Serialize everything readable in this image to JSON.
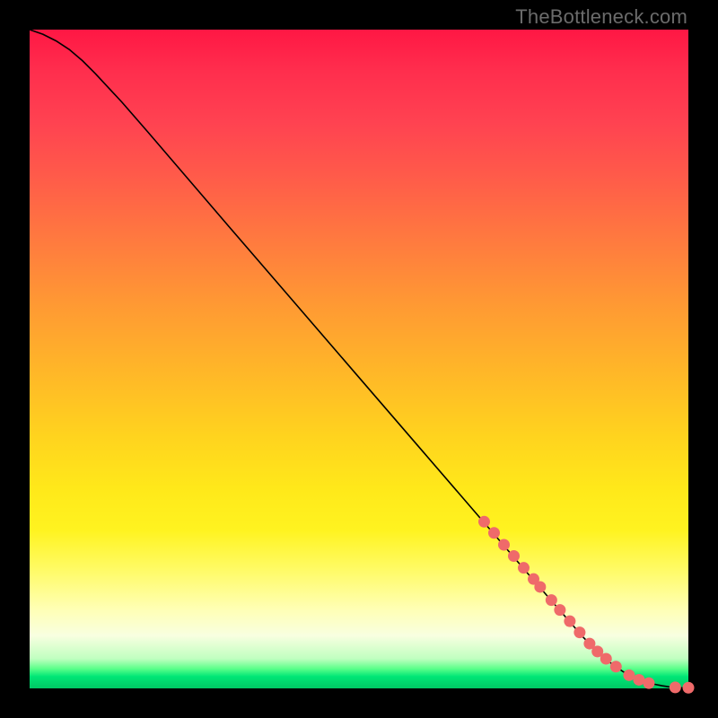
{
  "watermark": "TheBottleneck.com",
  "chart_data": {
    "type": "line",
    "title": "",
    "xlabel": "",
    "ylabel": "",
    "xlim": [
      0,
      100
    ],
    "ylim": [
      0,
      100
    ],
    "grid": false,
    "legend": false,
    "series": [
      {
        "name": "curve",
        "color": "#000000",
        "x": [
          0,
          2,
          4,
          6,
          8,
          10,
          14,
          18,
          24,
          30,
          40,
          50,
          60,
          70,
          76,
          80,
          84,
          86,
          88,
          90,
          91,
          92,
          93,
          94.5,
          96,
          97,
          98,
          99,
          100
        ],
        "y": [
          100,
          99.3,
          98.3,
          97.0,
          95.3,
          93.3,
          89.0,
          84.4,
          77.4,
          70.4,
          58.8,
          47.2,
          35.6,
          24.0,
          17.0,
          12.4,
          7.8,
          5.8,
          4.0,
          2.6,
          2.0,
          1.5,
          1.1,
          0.7,
          0.4,
          0.25,
          0.15,
          0.1,
          0.1
        ]
      }
    ],
    "markers": {
      "name": "dots",
      "color": "#ef6a6a",
      "radius_px": 6.5,
      "points": [
        {
          "x": 69.0,
          "y": 25.3
        },
        {
          "x": 70.5,
          "y": 23.6
        },
        {
          "x": 72.0,
          "y": 21.8
        },
        {
          "x": 73.5,
          "y": 20.1
        },
        {
          "x": 75.0,
          "y": 18.3
        },
        {
          "x": 76.5,
          "y": 16.6
        },
        {
          "x": 77.5,
          "y": 15.4
        },
        {
          "x": 79.2,
          "y": 13.4
        },
        {
          "x": 80.5,
          "y": 11.9
        },
        {
          "x": 82.0,
          "y": 10.2
        },
        {
          "x": 83.5,
          "y": 8.5
        },
        {
          "x": 85.0,
          "y": 6.8
        },
        {
          "x": 86.2,
          "y": 5.6
        },
        {
          "x": 87.5,
          "y": 4.5
        },
        {
          "x": 89.0,
          "y": 3.3
        },
        {
          "x": 91.0,
          "y": 2.0
        },
        {
          "x": 92.5,
          "y": 1.3
        },
        {
          "x": 94.0,
          "y": 0.8
        },
        {
          "x": 98.0,
          "y": 0.15
        },
        {
          "x": 100.0,
          "y": 0.1
        }
      ]
    }
  }
}
